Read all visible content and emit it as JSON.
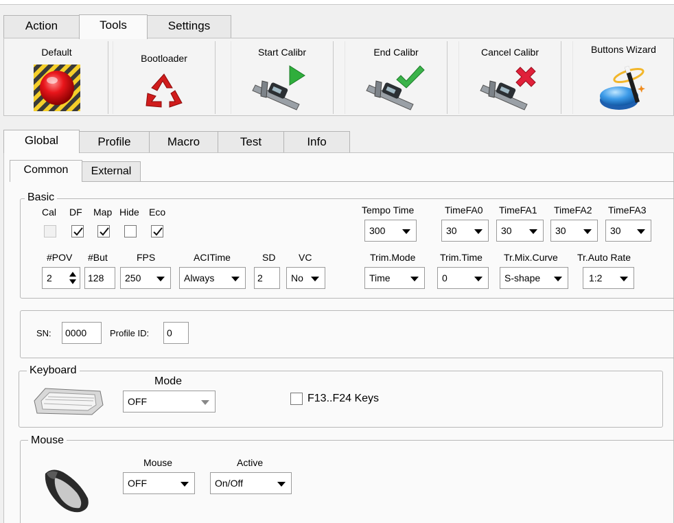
{
  "main_tabs": [
    "Action",
    "Tools",
    "Settings"
  ],
  "toolbar": {
    "default": "Default",
    "bootloader": "Bootloader",
    "start_calibr": "Start Calibr",
    "end_calibr": "End Calibr",
    "cancel_calibr": "Cancel Calibr",
    "buttons_wizard": "Buttons Wizard"
  },
  "section_tabs": [
    "Global",
    "Profile",
    "Macro",
    "Test",
    "Info"
  ],
  "sub_tabs": [
    "Common",
    "External"
  ],
  "basic": {
    "title": "Basic",
    "checks": [
      {
        "label": "Cal",
        "checked": false,
        "disabled": true
      },
      {
        "label": "DF",
        "checked": true
      },
      {
        "label": "Map",
        "checked": true
      },
      {
        "label": "Hide",
        "checked": false
      },
      {
        "label": "Eco",
        "checked": true
      }
    ],
    "tempo_time_label": "Tempo Time",
    "tempo_time": "300",
    "timefa0_label": "TimeFA0",
    "timefa0": "30",
    "timefa1_label": "TimeFA1",
    "timefa1": "30",
    "timefa2_label": "TimeFA2",
    "timefa2": "30",
    "timefa3_label": "TimeFA3",
    "timefa3": "30",
    "pov_label": "#POV",
    "pov": "2",
    "but_label": "#But",
    "but": "128",
    "fps_label": "FPS",
    "fps": "250",
    "acitime_label": "ACITime",
    "acitime": "Always",
    "sd_label": "SD",
    "sd": "2",
    "vc_label": "VC",
    "vc": "No",
    "trim_mode_label": "Trim.Mode",
    "trim_mode": "Time",
    "trim_time_label": "Trim.Time",
    "trim_time": "0",
    "tr_mix_curve_label": "Tr.Mix.Curve",
    "tr_mix_curve": "S-shape",
    "tr_auto_rate_label": "Tr.Auto Rate",
    "tr_auto_rate": "1:2"
  },
  "ids": {
    "sn_label": "SN:",
    "sn": "0000",
    "profile_id_label": "Profile ID:",
    "profile_id": "0"
  },
  "keyboard": {
    "title": "Keyboard",
    "mode_label": "Mode",
    "mode": "OFF",
    "f13_label": "F13..F24 Keys",
    "f13_checked": false
  },
  "mouse": {
    "title": "Mouse",
    "mouse_label": "Mouse",
    "mouse": "OFF",
    "active_label": "Active",
    "active": "On/Off"
  },
  "colors": {
    "accent_green": "#2fae3c",
    "cancel_red": "#e0213a",
    "recycle_red": "#d01c1c"
  }
}
